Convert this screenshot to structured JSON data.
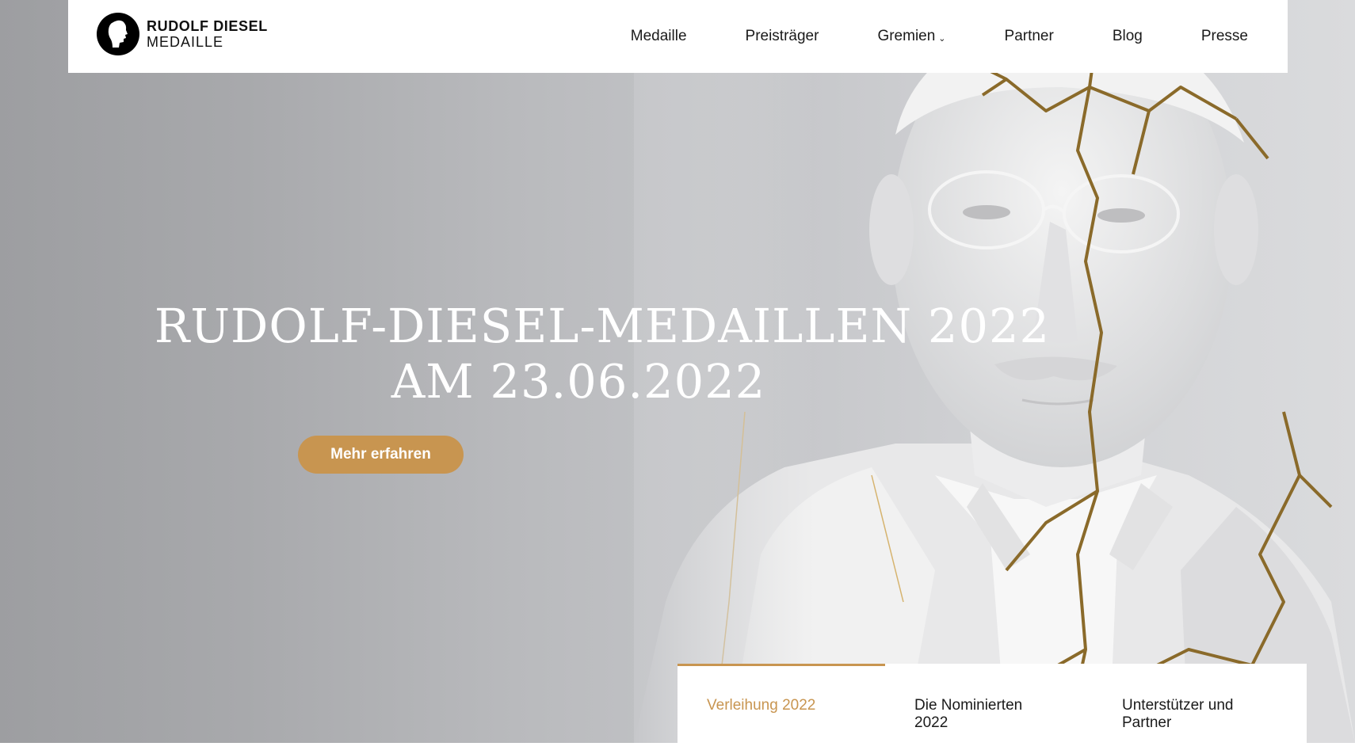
{
  "brand": {
    "line1": "RUDOLF DIESEL",
    "line2": "MEDAILLE"
  },
  "nav": {
    "items": [
      {
        "label": "Medaille"
      },
      {
        "label": "Preisträger"
      },
      {
        "label": "Gremien",
        "has_dropdown": true
      },
      {
        "label": "Partner"
      },
      {
        "label": "Blog"
      },
      {
        "label": "Presse"
      }
    ],
    "dropdown_icon": "chevron-down-icon"
  },
  "hero": {
    "title_line1": "RUDOLF-DIESEL-MEDAILLEN 2022",
    "title_line2": "AM 23.06.2022",
    "cta_label": "Mehr erfahren"
  },
  "tabs": [
    {
      "label": "Verleihung 2022",
      "active": true
    },
    {
      "label": "Die Nominierten 2022",
      "active": false
    },
    {
      "label": "Unterstützer und Partner",
      "active": false
    }
  ],
  "colors": {
    "accent": "#c89550",
    "text": "#1a1a1a",
    "hero_text": "#ffffff"
  }
}
